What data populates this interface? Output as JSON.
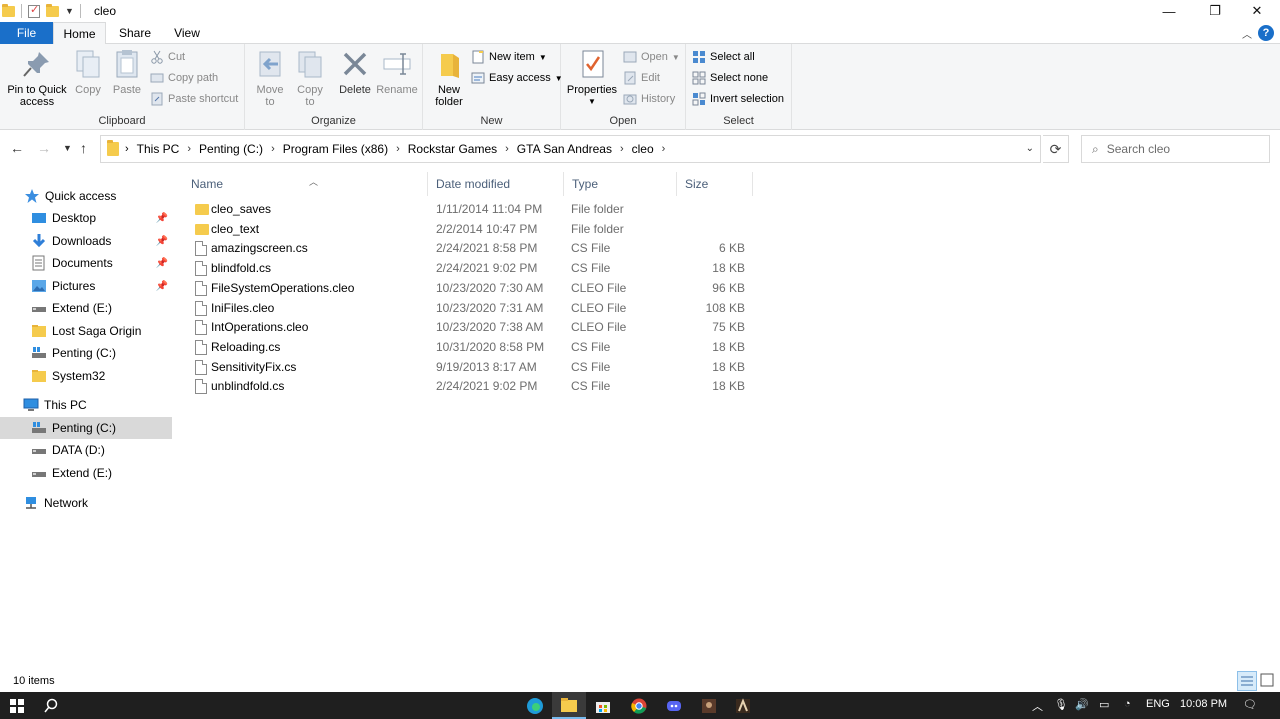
{
  "window": {
    "title": "cleo",
    "minimize": "—",
    "restore": "❐",
    "close": "✕"
  },
  "ribbon_tabs": {
    "file": "File",
    "home": "Home",
    "share": "Share",
    "view": "View"
  },
  "help": "?",
  "clipboard": {
    "label": "Clipboard",
    "pin": "Pin to Quick access",
    "copy": "Copy",
    "paste": "Paste",
    "cut": "Cut",
    "copy_path": "Copy path",
    "paste_shortcut": "Paste shortcut"
  },
  "organize": {
    "label": "Organize",
    "move_to": "Move to",
    "copy_to": "Copy to",
    "delete": "Delete",
    "rename": "Rename"
  },
  "new": {
    "label": "New",
    "new_folder": "New folder",
    "new_item": "New item",
    "easy_access": "Easy access"
  },
  "open": {
    "label": "Open",
    "properties": "Properties",
    "open": "Open",
    "edit": "Edit",
    "history": "History"
  },
  "select": {
    "label": "Select",
    "select_all": "Select all",
    "select_none": "Select none",
    "invert": "Invert selection"
  },
  "address": {
    "crumbs": [
      "This PC",
      "Penting (C:)",
      "Program Files (x86)",
      "Rockstar Games",
      "GTA San Andreas",
      "cleo"
    ],
    "search_placeholder": "Search cleo"
  },
  "nav": {
    "quick_access": "Quick access",
    "desktop": "Desktop",
    "downloads": "Downloads",
    "documents": "Documents",
    "pictures": "Pictures",
    "extend_e_1": "Extend (E:)",
    "lost_saga": "Lost Saga Origin",
    "penting_c_1": "Penting (C:)",
    "system32": "System32",
    "this_pc": "This PC",
    "penting_c_2": "Penting (C:)",
    "data_d": "DATA (D:)",
    "extend_e_2": "Extend (E:)",
    "network": "Network"
  },
  "columns": {
    "name": "Name",
    "date": "Date modified",
    "type": "Type",
    "size": "Size"
  },
  "files": [
    {
      "name": "cleo_saves",
      "date": "1/11/2014 11:04 PM",
      "type": "File folder",
      "size": ""
    },
    {
      "name": "cleo_text",
      "date": "2/2/2014 10:47 PM",
      "type": "File folder",
      "size": ""
    },
    {
      "name": "amazingscreen.cs",
      "date": "2/24/2021 8:58 PM",
      "type": "CS File",
      "size": "6 KB"
    },
    {
      "name": "blindfold.cs",
      "date": "2/24/2021 9:02 PM",
      "type": "CS File",
      "size": "18 KB"
    },
    {
      "name": "FileSystemOperations.cleo",
      "date": "10/23/2020 7:30 AM",
      "type": "CLEO File",
      "size": "96 KB"
    },
    {
      "name": "IniFiles.cleo",
      "date": "10/23/2020 7:31 AM",
      "type": "CLEO File",
      "size": "108 KB"
    },
    {
      "name": "IntOperations.cleo",
      "date": "10/23/2020 7:38 AM",
      "type": "CLEO File",
      "size": "75 KB"
    },
    {
      "name": "Reloading.cs",
      "date": "10/31/2020 8:58 PM",
      "type": "CS File",
      "size": "18 KB"
    },
    {
      "name": "SensitivityFix.cs",
      "date": "9/19/2013 8:17 AM",
      "type": "CS File",
      "size": "18 KB"
    },
    {
      "name": "unblindfold.cs",
      "date": "2/24/2021 9:02 PM",
      "type": "CS File",
      "size": "18 KB"
    }
  ],
  "status": {
    "count": "10 items"
  },
  "taskbar": {
    "lang": "ENG",
    "time": "10:08 PM"
  },
  "colors": {
    "accent": "#1a6fc9",
    "folder": "#f5cb4d",
    "taskbar": "#1f1f1f"
  }
}
